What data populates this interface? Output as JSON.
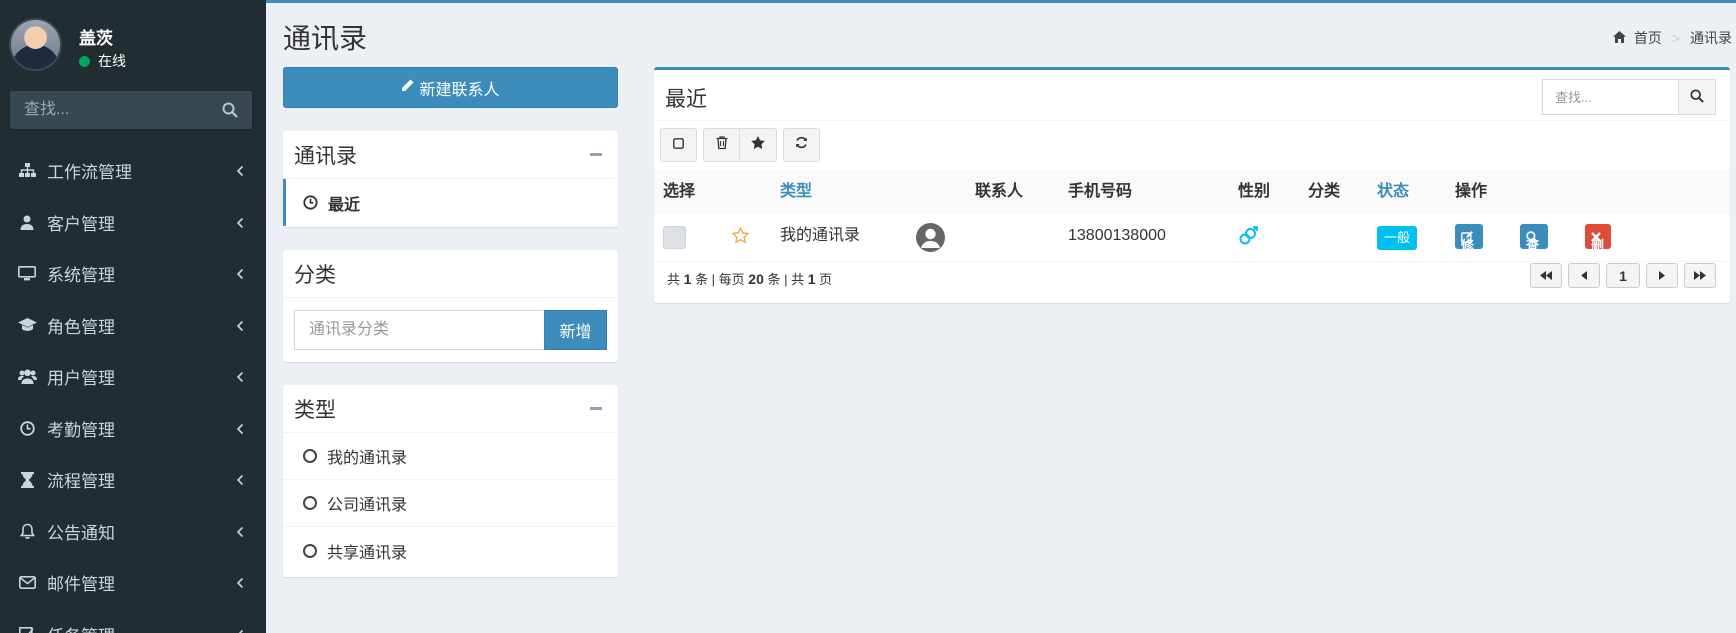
{
  "user": {
    "name": "盖茨",
    "status": "在线"
  },
  "sidebar": {
    "search_placeholder": "查找...",
    "items": [
      {
        "label": "工作流管理",
        "icon": "sitemap-icon"
      },
      {
        "label": "客户管理",
        "icon": "user-icon"
      },
      {
        "label": "系统管理",
        "icon": "desktop-icon"
      },
      {
        "label": "角色管理",
        "icon": "graduation-cap-icon"
      },
      {
        "label": "用户管理",
        "icon": "users-icon"
      },
      {
        "label": "考勤管理",
        "icon": "clock-icon"
      },
      {
        "label": "流程管理",
        "icon": "hourglass-icon"
      },
      {
        "label": "公告通知",
        "icon": "bell-icon"
      },
      {
        "label": "邮件管理",
        "icon": "envelope-icon"
      },
      {
        "label": "任务管理",
        "icon": "task-icon"
      }
    ]
  },
  "header": {
    "title": "通讯录",
    "breadcrumb": [
      "首页",
      "通讯录"
    ]
  },
  "left": {
    "new_button": "新建联系人",
    "contacts_box": {
      "title": "通讯录",
      "items": [
        "最近"
      ]
    },
    "category_box": {
      "title": "分类",
      "input_placeholder": "通讯录分类",
      "add_button": "新增"
    },
    "type_box": {
      "title": "类型",
      "items": [
        "我的通讯录",
        "公司通讯录",
        "共享通讯录"
      ]
    }
  },
  "main": {
    "title": "最近",
    "search_placeholder": "查找...",
    "columns": [
      "选择",
      "类型",
      "联系人",
      "手机号码",
      "性别",
      "分类",
      "状态",
      "操作"
    ],
    "rows": [
      {
        "type": "我的通讯录",
        "contact": "",
        "phone": "13800138000",
        "category": "",
        "status": "一般"
      }
    ],
    "actions": {
      "edit": "修改",
      "view": "查看",
      "delete": "删除"
    },
    "footer": {
      "p1": "共",
      "total": "1",
      "p2": "条 | 每页",
      "per_page": "20",
      "p3": "条 | 共",
      "pages": "1",
      "p4": "页"
    },
    "pager": {
      "current": "1"
    }
  },
  "colors": {
    "primary": "#3c8dbc",
    "danger": "#dd4b39",
    "info": "#00c0ef",
    "sidebar_bg": "#222d32",
    "success": "#00a65a"
  }
}
